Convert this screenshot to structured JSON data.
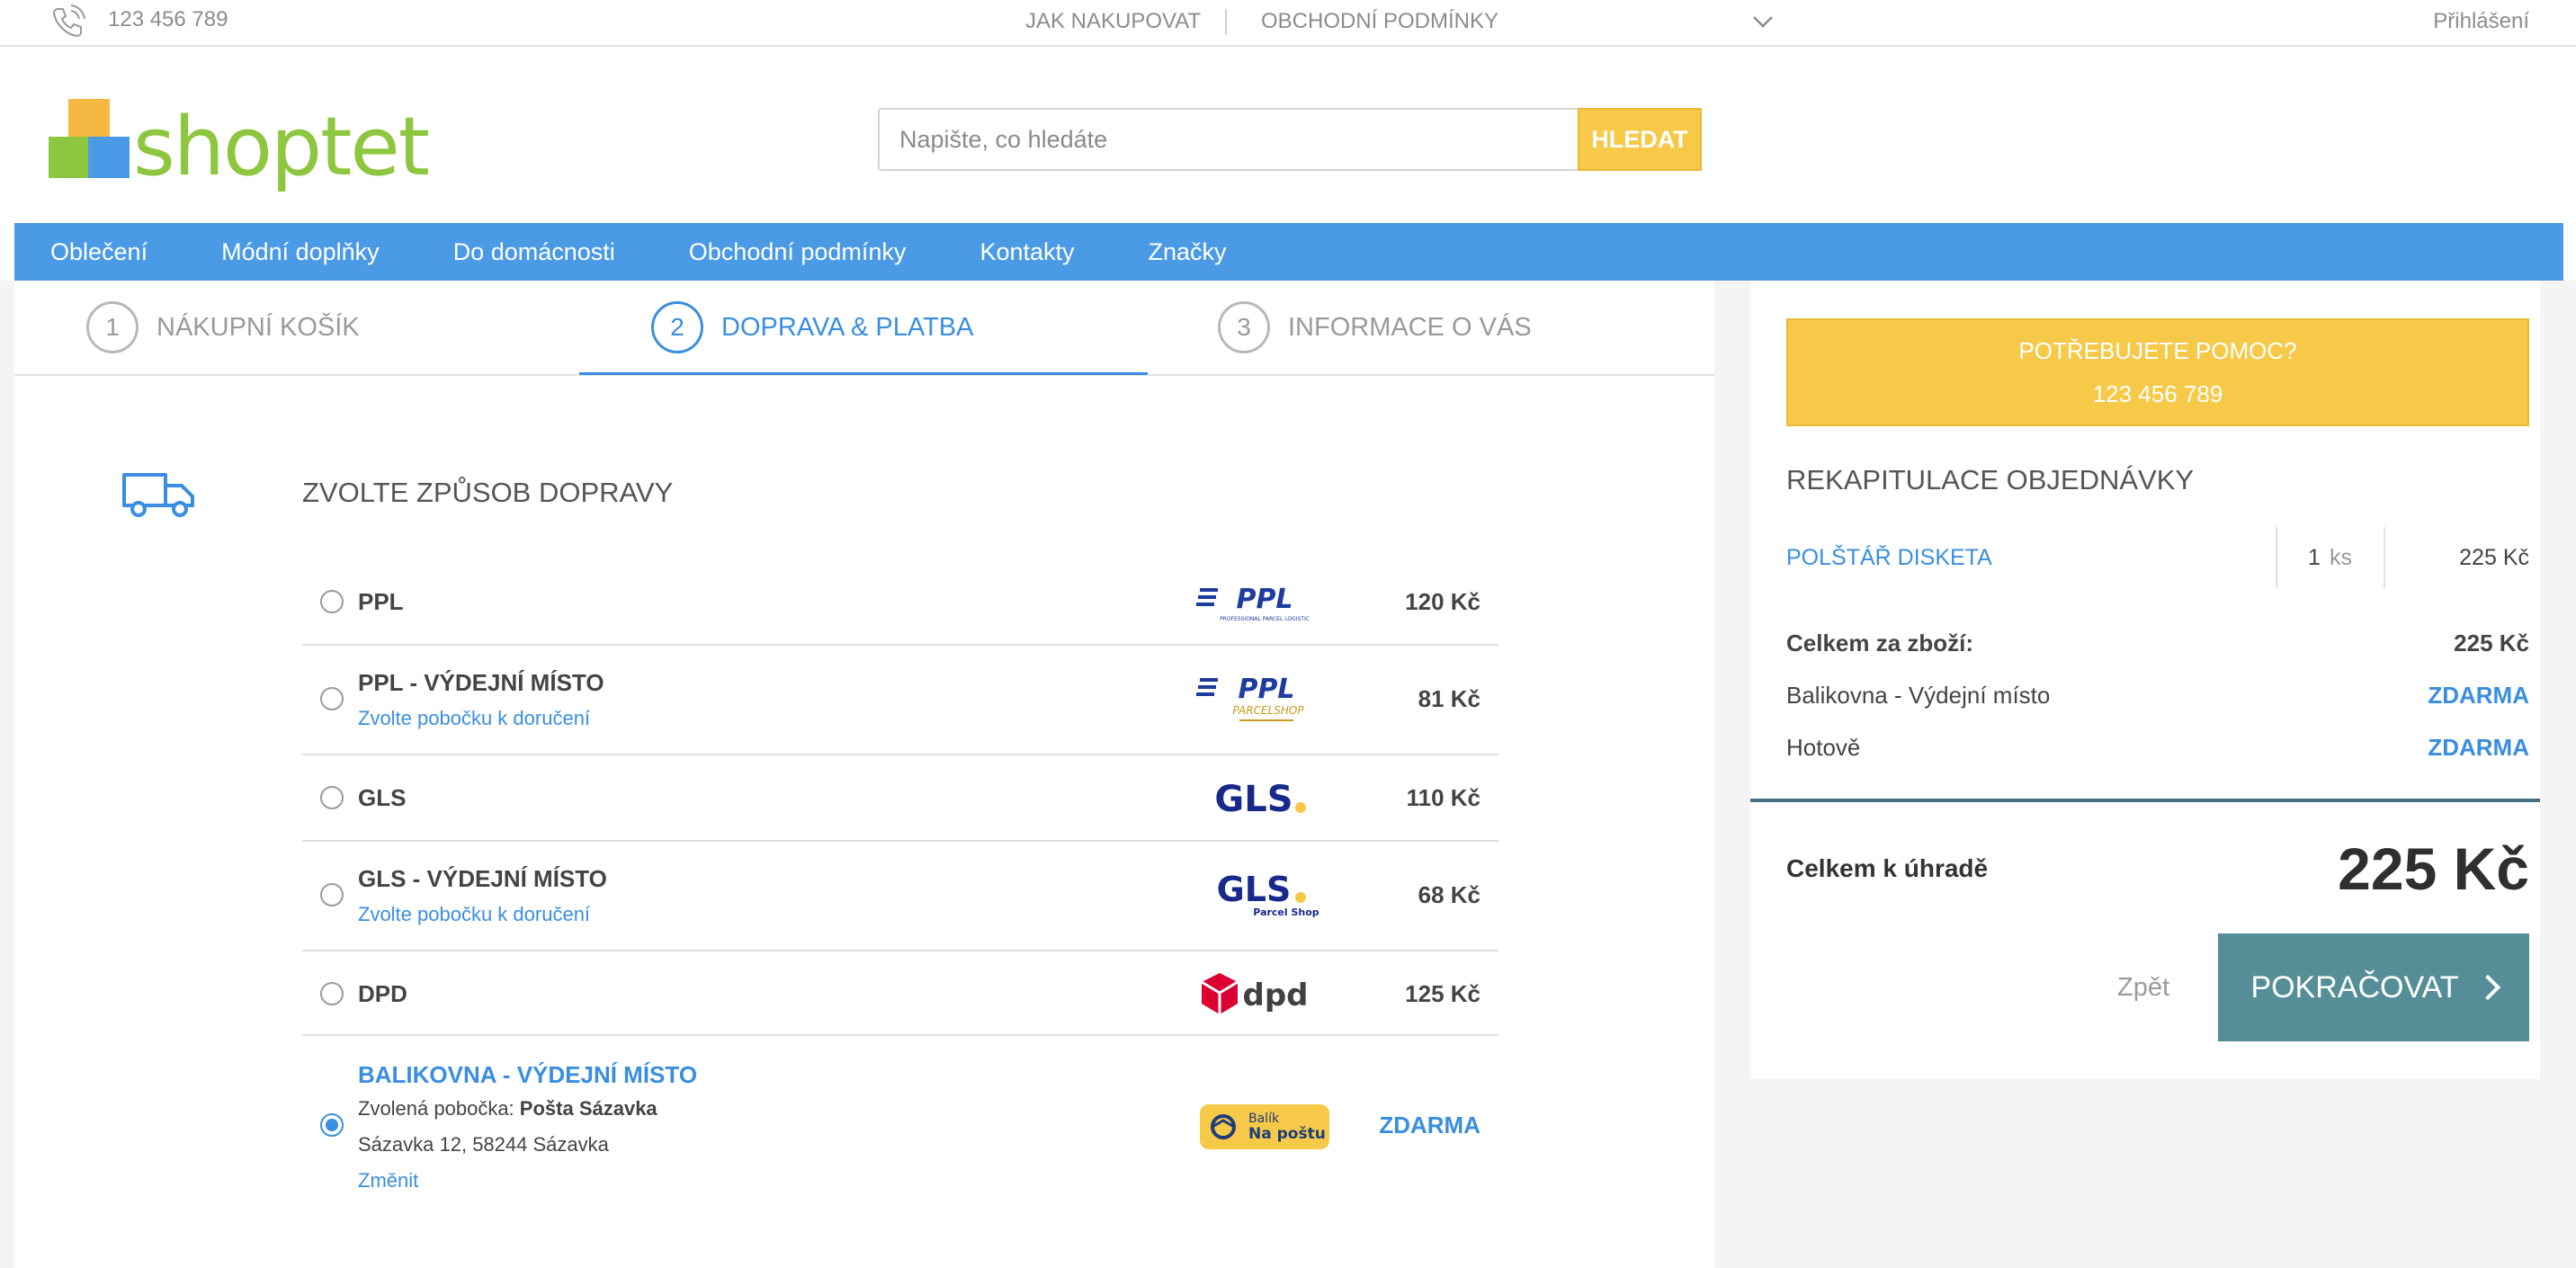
{
  "topbar": {
    "phone": "123 456 789",
    "links": [
      "JAK NAKUPOVAT",
      "OBCHODNÍ PODMÍNKY"
    ],
    "login": "Přihlášení"
  },
  "header": {
    "logo_text": "shoptet",
    "search_placeholder": "Napište, co hledáte",
    "search_button": "HLEDAT"
  },
  "nav": [
    "Oblečení",
    "Módní doplňky",
    "Do domácnosti",
    "Obchodní podmínky",
    "Kontakty",
    "Značky"
  ],
  "steps": [
    {
      "num": "1",
      "label": "NÁKUPNÍ KOŠÍK"
    },
    {
      "num": "2",
      "label": "DOPRAVA & PLATBA"
    },
    {
      "num": "3",
      "label": "INFORMACE O VÁS"
    }
  ],
  "shipping": {
    "title": "ZVOLTE ZPŮSOB DOPRAVY",
    "options": [
      {
        "name": "PPL",
        "price": "120 Kč",
        "logo": "PPL"
      },
      {
        "name": "PPL - VÝDEJNÍ MÍSTO",
        "sub": "Zvolte pobočku k doručení",
        "price": "81 Kč",
        "logo": "PPL",
        "logo_sub": "PARCELSHOP"
      },
      {
        "name": "GLS",
        "price": "110 Kč",
        "logo": "GLS"
      },
      {
        "name": "GLS - VÝDEJNÍ MÍSTO",
        "sub": "Zvolte pobočku k doručení",
        "price": "68 Kč",
        "logo": "GLS",
        "logo_sub": "Parcel Shop"
      },
      {
        "name": "DPD",
        "price": "125 Kč",
        "logo": "dpd"
      },
      {
        "name": "BALIKOVNA - VÝDEJNÍ MÍSTO",
        "selected_prefix": "Zvolená pobočka:",
        "selected_branch": "Pošta Sázavka",
        "address": "Sázavka 12, 58244 Sázavka",
        "change": "Změnit",
        "price": "ZDARMA",
        "logo_line1": "Balík",
        "logo_line2": "Na poštu"
      }
    ],
    "ppl_logo_tagline": "PROFESSIONAL PARCEL LOGISTIC"
  },
  "summary": {
    "help_line1": "POTŘEBUJETE POMOC?",
    "help_line2": "123 456 789",
    "title": "REKAPITULACE OBJEDNÁVKY",
    "item": {
      "name": "POLŠTÁŘ DISKETA",
      "qty": "1",
      "unit": "ks",
      "price": "225 Kč"
    },
    "goods_total_label": "Celkem za zboží:",
    "goods_total_value": "225 Kč",
    "shipping_label": "Balikovna - Výdejní místo",
    "shipping_value": "ZDARMA",
    "payment_label": "Hotově",
    "payment_value": "ZDARMA",
    "total_label": "Celkem k úhradě",
    "total_value": "225 Kč",
    "back": "Zpět",
    "continue": "POKRAČOVAT"
  },
  "colors": {
    "accent_blue": "#3a8ee0",
    "nav_blue": "#4a9ae5",
    "yellow": "#f7c948",
    "continue": "#568e98"
  }
}
